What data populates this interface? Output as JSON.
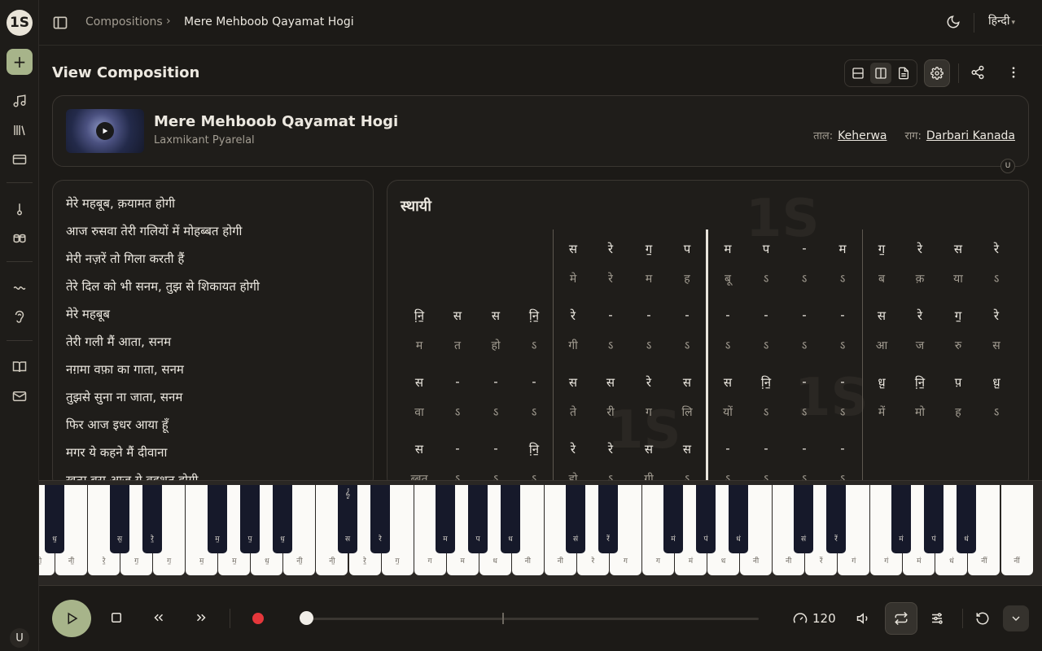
{
  "rail": {
    "logo": "1S",
    "new_symbol": "+",
    "user_initial": "U"
  },
  "topbar": {
    "breadcrumb_parent": "Compositions",
    "breadcrumb_sep": "›",
    "breadcrumb_current": "Mere Mehboob Qayamat Hogi",
    "language": "हिन्दी"
  },
  "header": {
    "title": "View Composition"
  },
  "song": {
    "title": "Mere Mehboob Qayamat Hogi",
    "artist": "Laxmikant Pyarelal",
    "taal_label": "ताल:",
    "taal_value": "Keherwa",
    "raag_label": "राग:",
    "raag_value": "Darbari Kanada",
    "owner_badge": "U"
  },
  "lyrics": [
    "मेरे महबूब, क़यामत होगी",
    "आज रुसवा तेरी गलियों में मोहब्बत होगी",
    "मेरी नज़रें तो गिला करती हैं",
    "तेरे दिल को भी सनम, तुझ से शिकायत होगी",
    "मेरे महबूब",
    "तेरी गली मैं आता, सनम",
    "नग़मा वफ़ा का गाता, सनम",
    "तुझसे सुना ना जाता, सनम",
    "फिर आज इधर आया हूँ",
    "मगर ये कहने मैं दीवाना",
    "ख़त्म बस आज ये वहशत होगी"
  ],
  "notation": {
    "section_title": "स्थायी",
    "watermark": "1S",
    "rows": [
      {
        "swar": [
          "",
          "",
          "",
          "",
          "स",
          "रे",
          "ग॒",
          "प",
          "म",
          "प",
          "-",
          "म",
          "ग॒",
          "रे",
          "स",
          "रे"
        ],
        "lyric": [
          "",
          "",
          "",
          "",
          "मे",
          "रे",
          "म",
          "ह",
          "बू",
          "ऽ",
          "ऽ",
          "ऽ",
          "ब",
          "क़",
          "या",
          "ऽ"
        ]
      },
      {
        "swar": [
          "नि़॒",
          "स",
          "स",
          "नि़॒",
          "रे",
          "-",
          "-",
          "-",
          "-",
          "-",
          "-",
          "-",
          "स",
          "रे",
          "ग॒",
          "रे"
        ],
        "lyric": [
          "म",
          "त",
          "हो",
          "ऽ",
          "गी",
          "ऽ",
          "ऽ",
          "ऽ",
          "ऽ",
          "ऽ",
          "ऽ",
          "ऽ",
          "आ",
          "ज",
          "रु",
          "स"
        ]
      },
      {
        "swar": [
          "स",
          "-",
          "-",
          "-",
          "स",
          "स",
          "रे",
          "स",
          "स",
          "नि़॒",
          "-",
          "-",
          "ध़॒",
          "नि़॒",
          "प़",
          "ध़॒"
        ],
        "lyric": [
          "वा",
          "ऽ",
          "ऽ",
          "ऽ",
          "ते",
          "री",
          "ग",
          "लि",
          "यों",
          "ऽ",
          "ऽ",
          "ऽ",
          "में",
          "मो",
          "ह",
          "ऽ"
        ]
      },
      {
        "swar": [
          "स",
          "-",
          "-",
          "नि़॒",
          "रे",
          "रे",
          "स",
          "स",
          "-",
          "-",
          "-",
          "-",
          "",
          "",
          "",
          ""
        ],
        "lyric": [
          "ब्बत",
          "ऽ",
          "ऽ",
          "ऽ",
          "हो",
          "ऽ",
          "गी",
          "ऽ",
          "ऽ",
          "ऽ",
          "ऽ",
          "ऽ",
          "",
          "",
          "",
          ""
        ]
      }
    ]
  },
  "keyboard": {
    "white_labels": [
      "नी॒",
      "नी॒",
      "रे॒",
      "ग॒",
      "ग॒",
      "म॒",
      "म॒",
      "ध॒",
      "नी॒",
      "नी॒",
      "रे॒",
      "ग॒",
      "ग",
      "म",
      "ध",
      "नी",
      "नी",
      "रे",
      "ग",
      "ग",
      "मं",
      "ध",
      "नी",
      "नी",
      "रें",
      "गं",
      "गं",
      "मं",
      "धं",
      "नीं",
      "नीं"
    ],
    "black_labels": [
      "ध॒",
      "स॒",
      "रे॒",
      "म॒",
      "प॒",
      "ध॒",
      "स",
      "रे",
      "म",
      "प",
      "ध",
      "सं",
      "रें",
      "मं",
      "पं",
      "धं",
      "सं",
      "रें",
      "मं",
      "पं",
      "धं"
    ],
    "marker": "𝄞"
  },
  "transport": {
    "tempo": "120"
  },
  "colors": {
    "accent": "#a7b48a",
    "record": "#e5373b",
    "background": "#1c1a17"
  }
}
